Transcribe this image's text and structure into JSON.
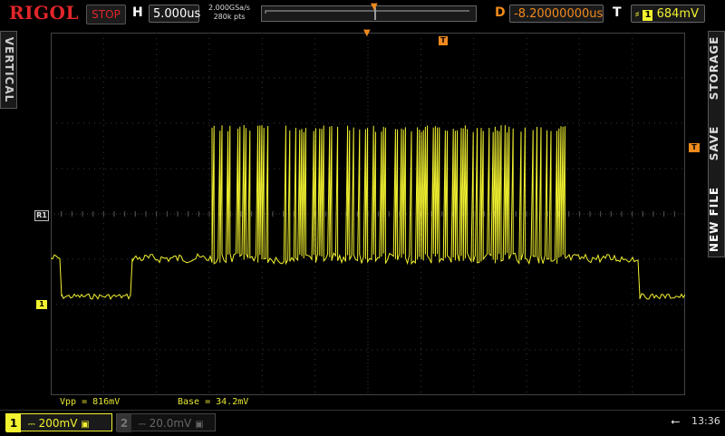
{
  "brand": "RIGOL",
  "run_state": "STOP",
  "timebase": {
    "letter": "H",
    "value": "5.000us"
  },
  "sample": {
    "rate": "2.000GSa/s",
    "points": "280k pts"
  },
  "delay": {
    "letter": "D",
    "value": "-8.20000000us"
  },
  "trigger": {
    "letter": "T",
    "edge_icon": "rising-edge-icon",
    "source": "1",
    "level": "684mV"
  },
  "left_tab": "VERTICAL",
  "right_tabs": [
    "STORAGE",
    "SAVE",
    "NEW FILE"
  ],
  "markers": {
    "ref_r1": "R1",
    "ch1": "1",
    "trig_pos": "T",
    "trig_level": "T"
  },
  "measurements": {
    "vpp": "Vpp = 816mV",
    "base": "Base = 34.2mV"
  },
  "channels": [
    {
      "number": "1",
      "coupling_icon": "dc-coupling-icon",
      "scale": "200mV",
      "bw_icon": "bandwidth-limit-icon"
    },
    {
      "number": "2",
      "coupling_icon": "dc-coupling-icon",
      "scale": "20.0mV",
      "bw_icon": "bandwidth-limit-icon"
    }
  ],
  "status": {
    "usb_icon": "usb-icon",
    "time": "13:36"
  },
  "colors": {
    "ch1": "#f2f230",
    "ch2_dim": "#666666",
    "brand": "#e0262a",
    "trigger": "#f08a1c",
    "grid": "#3a3a3a"
  }
}
